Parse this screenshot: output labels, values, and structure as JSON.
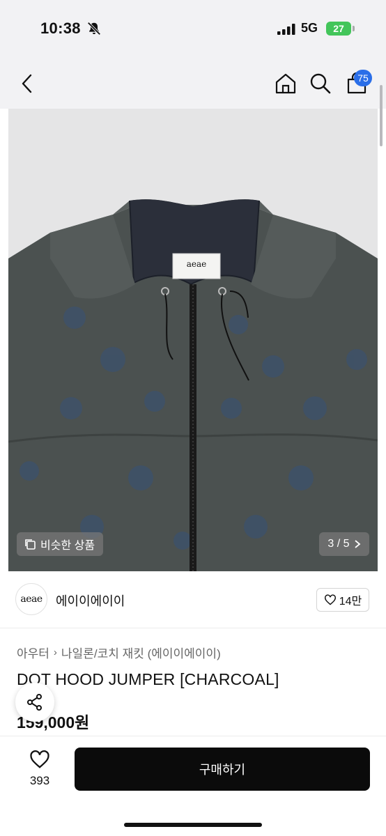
{
  "status_bar": {
    "time": "10:38",
    "network": "5G",
    "battery": "27",
    "icons": [
      "bell-slash-icon",
      "signal-icon"
    ]
  },
  "nav": {
    "back_icon": "chevron-left-icon",
    "home_icon": "home-icon",
    "search_icon": "search-icon",
    "cart_icon": "shopping-bag-icon",
    "cart_count": "75"
  },
  "image": {
    "tag_label": "aeae",
    "similar_label": "비슷한 상품",
    "page_indicator": "3 / 5"
  },
  "shop": {
    "logo_text": "aeae",
    "name": "에이이에이이",
    "likes": "14만"
  },
  "product": {
    "breadcrumb": [
      "아우터",
      "나일론/코치 재킷 (에이이에이이)"
    ],
    "title": "DOT HOOD JUMPER [CHARCOAL]",
    "price": "159,000원"
  },
  "bottom": {
    "wish_count": "393",
    "buy_label": "구매하기"
  },
  "colors": {
    "badge": "#2a6ee8",
    "battery": "#43c55a",
    "buy_button": "#0b0b0b",
    "jacket": "#4a504f"
  }
}
